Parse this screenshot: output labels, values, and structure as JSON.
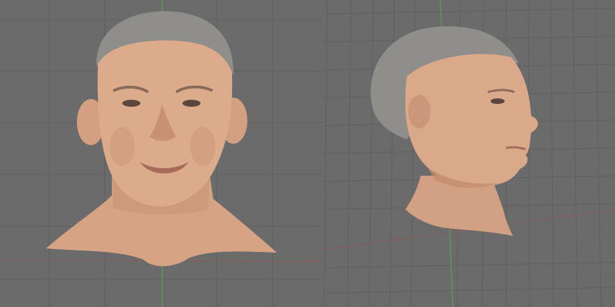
{
  "viewports": [
    {
      "id": "front",
      "view": "front",
      "subject": "textured-head-model",
      "grid": true,
      "background": "#6b6b6b",
      "grid_color": "#5e5e5e",
      "x_axis_color": "#8a5a5a",
      "y_axis_color": "#5aa05a"
    },
    {
      "id": "side",
      "view": "side-perspective",
      "subject": "textured-head-model",
      "grid": true,
      "background": "#6b6b6b",
      "grid_color": "#5e5e5e",
      "x_axis_color": "#8a5a5a",
      "y_axis_color": "#5aa05a"
    }
  ],
  "skin_colors": {
    "base": "#d9a889",
    "shade": "#b98366",
    "hair": "#8c8c88"
  }
}
